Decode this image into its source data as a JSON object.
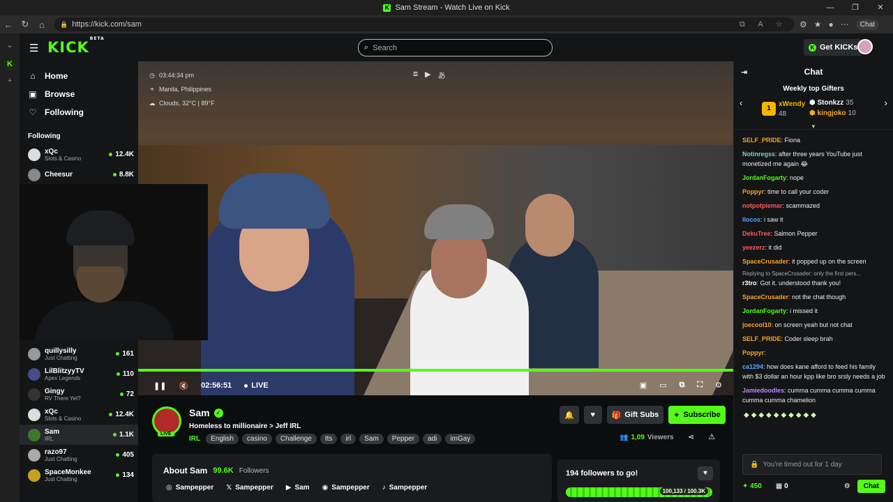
{
  "window": {
    "title": "Sam Stream - Watch Live on Kick"
  },
  "browser": {
    "url": "https://kick.com/sam",
    "copilot_label": "Chat"
  },
  "topnav": {
    "logo": "KICK",
    "logo_beta": "BETA",
    "search_placeholder": "Search",
    "get_kicks": "Get KICKs"
  },
  "sidebar": {
    "nav": [
      {
        "label": "Home",
        "icon": "home-icon"
      },
      {
        "label": "Browse",
        "icon": "browse-icon"
      },
      {
        "label": "Following",
        "icon": "heart-icon"
      }
    ],
    "following_heading": "Following",
    "channels_top": [
      {
        "name": "xQc",
        "category": "Slots & Casino",
        "viewers": "12.4K"
      },
      {
        "name": "Cheesur",
        "category": "",
        "viewers": "8.8K"
      }
    ],
    "channels_bottom": [
      {
        "name": "",
        "category": "Slots & Casino",
        "viewers": ""
      },
      {
        "name": "quillysilly",
        "category": "Just Chatting",
        "viewers": "161"
      },
      {
        "name": "LilBlitzyyTV",
        "category": "Apex Legends",
        "viewers": "110"
      },
      {
        "name": "Gingy",
        "category": "RV There Yet?",
        "viewers": "72"
      },
      {
        "name": "xQc",
        "category": "Slots & Casino",
        "viewers": "12.4K"
      },
      {
        "name": "Sam",
        "category": "IRL",
        "viewers": "1.1K"
      },
      {
        "name": "razo97",
        "category": "Just Chatting",
        "viewers": "405"
      },
      {
        "name": "SpaceMonkee",
        "category": "Just Chatting",
        "viewers": "134"
      }
    ]
  },
  "player": {
    "overlay_time": "03:44:34 pm",
    "overlay_location": "Manila, Philippines",
    "overlay_weather": "Clouds, 32°C | 89°F",
    "elapsed": "02:56:51",
    "live_label": "LIVE"
  },
  "channel": {
    "name": "Sam",
    "live_badge": "LIVE",
    "title": "Homeless to millionaire > Jeff IRL",
    "category": "IRL",
    "tags": [
      "English",
      "casino",
      "Challenge",
      "tts",
      "irl",
      "Sam",
      "Pepper",
      "adi",
      "imGay"
    ],
    "gift_subs": "Gift Subs",
    "subscribe": "Subscribe",
    "viewers_count": "1,09",
    "viewers_label": "Viewers"
  },
  "about": {
    "title": "About Sam",
    "followers_count": "99.6K",
    "followers_label": "Followers",
    "socials": [
      {
        "icon": "instagram-icon",
        "label": "Sampepper"
      },
      {
        "icon": "x-icon",
        "label": "Sampepper"
      },
      {
        "icon": "youtube-icon",
        "label": "Sam"
      },
      {
        "icon": "discord-icon",
        "label": "Sampepper"
      },
      {
        "icon": "tiktok-icon",
        "label": "Sampepper"
      }
    ]
  },
  "goal": {
    "title": "194 followers to go!",
    "progress_text": "100,133 / 100.3K",
    "progress": 0.998
  },
  "chat": {
    "title": "Chat",
    "gifters_title": "Weekly top Gifters",
    "top_gifter": {
      "rank": "1",
      "name": "xWendy",
      "count": "48"
    },
    "gifter_2": {
      "name": "Stonkzz",
      "count": "35"
    },
    "gifter_3": {
      "name": "kingjoko",
      "count": "10"
    },
    "messages": [
      {
        "user": "SELF_PRIDE",
        "color": "#f5a623",
        "text": "Fiona"
      },
      {
        "user": "Notinregss",
        "color": "#7fd3c5",
        "text": "after three years YouTube just monetized me again 😂"
      },
      {
        "user": "JordanFogarty",
        "color": "#53fc18",
        "text": "nope"
      },
      {
        "user": "Poppyr",
        "color": "#f5a623",
        "text": "time to call your coder"
      },
      {
        "user": "notpotpiemar",
        "color": "#ff5a5a",
        "text": "scammazed"
      },
      {
        "user": "llocos",
        "color": "#53a8ff",
        "text": "i saw it"
      },
      {
        "user": "DekuTree",
        "color": "#ff5a5a",
        "text": "Salmon Pepper"
      },
      {
        "user": "yeezerz",
        "color": "#ff5a5a",
        "text": "it did"
      },
      {
        "user": "SpaceCrusader",
        "color": "#f5a623",
        "text": "it popped up on the screen"
      },
      {
        "user": "r3tro",
        "color": "#ffffff",
        "text": "Got it. understood thank you!",
        "reply": "Replying to SpaceCrusader: only the first pers..."
      },
      {
        "user": "SpaceCrusader",
        "color": "#f5a623",
        "text": "not the chat though"
      },
      {
        "user": "JordanFogarty",
        "color": "#53fc18",
        "text": "i missed it"
      },
      {
        "user": "joecool10",
        "color": "#f5a623",
        "text": "on screen yeah but not chat"
      },
      {
        "user": "SELF_PRIDE",
        "color": "#f5a623",
        "text": "Coder sleep brah"
      },
      {
        "user": "Poppyr",
        "color": "#f5a623",
        "text": ""
      },
      {
        "user": "ca1294",
        "color": "#53a8ff",
        "text": "how does kane afford to feed his family with $3 dollar an hour kpp like bro srsly needs a job"
      },
      {
        "user": "Jamiedoodles",
        "color": "#b78cff",
        "text": "cumma cumma cumma cumma cumma cumma chamelion"
      }
    ],
    "input_placeholder": "You're timed out for 1 day",
    "points": "450",
    "slots": "0",
    "chat_button": "Chat"
  }
}
